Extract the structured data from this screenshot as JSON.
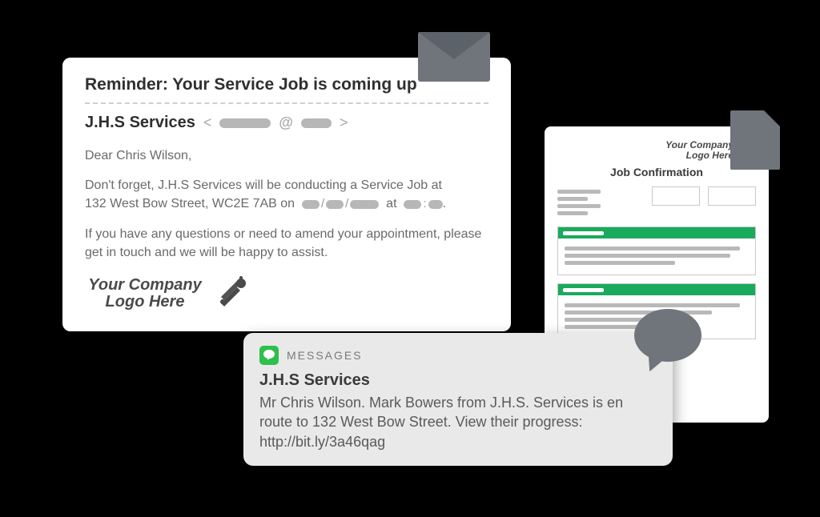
{
  "email": {
    "subject": "Reminder: Your Service Job is coming up",
    "sender_name": "J.H.S Services",
    "greeting": "Dear Chris Wilson,",
    "body_line1_a": "Don't forget, J.H.S Services will be conducting a Service Job at",
    "body_line1_b": "132 West Bow Street, WC2E 7AB on",
    "body_line1_at": "at",
    "body_line2": "If you have any questions or need to amend your appointment, please get in touch and we will be happy to assist.",
    "logo_text_1": "Your Company",
    "logo_text_2": "Logo Here"
  },
  "document": {
    "logo_text_1": "Your Company",
    "logo_text_2": "Logo Here",
    "title": "Job Confirmation"
  },
  "sms": {
    "app_label": "MESSAGES",
    "sender": "J.H.S Services",
    "body": "Mr Chris Wilson. Mark Bowers from J.H.S. Services is en route to 132 West Bow Street. View their progress: http://bit.ly/3a46qag"
  }
}
